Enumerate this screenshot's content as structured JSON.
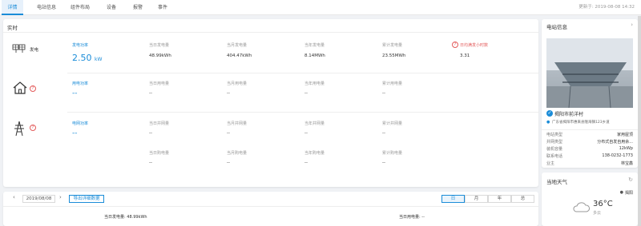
{
  "tabs": [
    {
      "label": "详情",
      "active": true
    },
    {
      "label": "电站信息"
    },
    {
      "label": "组件布局"
    },
    {
      "label": "设备"
    },
    {
      "label": "报警"
    },
    {
      "label": "事件"
    }
  ],
  "updated": "更新于: 2019-08-08 14:32",
  "realtime": {
    "title": "实时",
    "generation": {
      "name": "发电",
      "power_label": "发电功率",
      "power_value": "2.50",
      "power_unit": "kW",
      "stats": [
        {
          "label": "当日发电量",
          "value": "48.99kWh"
        },
        {
          "label": "当月发电量",
          "value": "404.47kWh"
        },
        {
          "label": "当年发电量",
          "value": "8.14MWh"
        },
        {
          "label": "累计发电量",
          "value": "23.55MWh"
        },
        {
          "label": "日均满发小时数",
          "value": "3.31"
        }
      ]
    },
    "usage": {
      "power_label": "用电功率",
      "power_value": "--",
      "stats": [
        {
          "label": "当日用电量",
          "value": "--"
        },
        {
          "label": "当月用电量",
          "value": "--"
        },
        {
          "label": "当年用电量",
          "value": "--"
        },
        {
          "label": "累计用电量",
          "value": "--"
        }
      ]
    },
    "grid": {
      "power_label": "电网功率",
      "power_value": "--",
      "export_stats": [
        {
          "label": "当日并网量",
          "value": "--"
        },
        {
          "label": "当月并网量",
          "value": "--"
        },
        {
          "label": "当年并网量",
          "value": "--"
        },
        {
          "label": "累计并网量",
          "value": "--"
        }
      ],
      "import_stats": [
        {
          "label": "当日购电量",
          "value": "--"
        },
        {
          "label": "当月购电量",
          "value": "--"
        },
        {
          "label": "当年购电量",
          "value": "--"
        },
        {
          "label": "累计购电量",
          "value": "--"
        }
      ]
    }
  },
  "history": {
    "date": "2019/08/08",
    "export_label": "导出详细数据",
    "periods": [
      "日",
      "月",
      "年",
      "总"
    ],
    "selected_period": "日",
    "gen_summary": "当日发电量: 48.99kWh",
    "use_summary": "当日用电量: --"
  },
  "station": {
    "title": "电站信息",
    "name": "揭阳市前洋村",
    "address": "广东省揭阳市惠来县隆海镇123乡道",
    "fields": [
      {
        "k": "电站类型",
        "v": "家用屋顶"
      },
      {
        "k": "并网类型",
        "v": "分布式自发自用余..."
      },
      {
        "k": "装机容量",
        "v": "12kWp"
      },
      {
        "k": "联系电话",
        "v": "138-0232-1773"
      },
      {
        "k": "业主",
        "v": "林宝鑫"
      }
    ]
  },
  "weather": {
    "title": "当地天气",
    "location": "揭阳",
    "temp": "36°C",
    "desc": "多云"
  }
}
